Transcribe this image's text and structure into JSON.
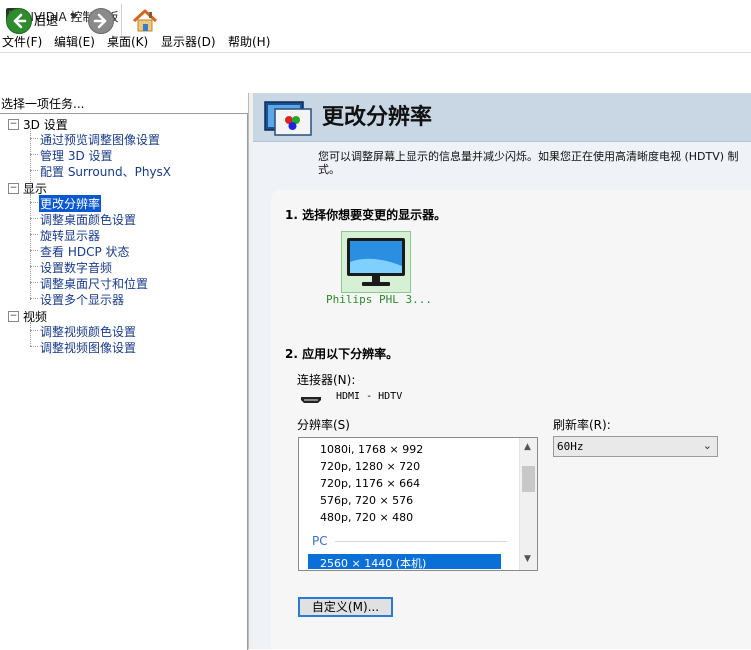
{
  "window": {
    "title": "NVIDIA 控制面板"
  },
  "menu": [
    "文件(F)",
    "编辑(E)",
    "桌面(K)",
    "显示器(D)",
    "帮助(H)"
  ],
  "toolbar": {
    "back_label": "后退"
  },
  "left": {
    "header": "选择一项任务...",
    "tree": [
      {
        "category": "3D 设置",
        "items": [
          "通过预览调整图像设置",
          "管理 3D 设置",
          "配置 Surround、PhysX"
        ]
      },
      {
        "category": "显示",
        "items": [
          "更改分辨率",
          "调整桌面颜色设置",
          "旋转显示器",
          "查看 HDCP 状态",
          "设置数字音频",
          "调整桌面尺寸和位置",
          "设置多个显示器"
        ]
      },
      {
        "category": "视频",
        "items": [
          "调整视频颜色设置",
          "调整视频图像设置"
        ]
      }
    ],
    "selected": "更改分辨率"
  },
  "page": {
    "title": "更改分辨率",
    "description": "您可以调整屏幕上显示的信息量并减少闪烁。如果您正在使用高清晰度电视 (HDTV) 制式。",
    "step1": "1. 选择你想要变更的显示器。",
    "monitor_name": "Philips PHL 3...",
    "step2": "2. 应用以下分辨率。",
    "connector_label": "连接器(N):",
    "connector_value": "HDMI - HDTV",
    "resolution_label": "分辨率(S)",
    "resolutions": [
      "1080i, 1768 × 992",
      "720p, 1280 × 720",
      "720p, 1176 × 664",
      "576p, 720 × 576",
      "480p, 720 × 480"
    ],
    "group_pc": "PC",
    "selected_resolution": "2560 × 1440 (本机)",
    "refresh_label": "刷新率(R):",
    "refresh_value": "60Hz",
    "custom_button": "自定义(M)..."
  }
}
